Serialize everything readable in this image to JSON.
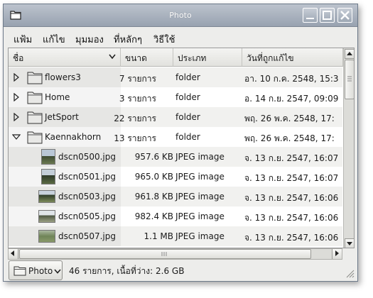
{
  "window": {
    "title": "Photo"
  },
  "menubar": {
    "items": [
      "แฟ้ม",
      "แก้ไข",
      "มุมมอง",
      "ที่หลักๆ",
      "วิธีใช้"
    ]
  },
  "columns": {
    "name": "ชื่อ",
    "size": "ขนาด",
    "type": "ประเภท",
    "modified": "วันที่ถูกแก้ไข"
  },
  "rows": [
    {
      "kind": "folder",
      "expanded": false,
      "name": "flowers3",
      "size": "7 รายการ",
      "type": "folder",
      "date": "อา. 10 ก.ค. 2548, 15:3"
    },
    {
      "kind": "folder",
      "expanded": false,
      "name": "Home",
      "size": "3 รายการ",
      "type": "folder",
      "date": "อ. 14 ก.ย. 2547, 09:09"
    },
    {
      "kind": "folder",
      "expanded": false,
      "name": "JetSport",
      "size": "22 รายการ",
      "type": "folder",
      "date": "พฤ. 26 พ.ค. 2548, 17:"
    },
    {
      "kind": "folder",
      "expanded": true,
      "name": "Kaennakhorn",
      "size": "13 รายการ",
      "type": "folder",
      "date": "พฤ. 26 พ.ค. 2548, 17:"
    },
    {
      "kind": "image",
      "name": "dscn0500.jpg",
      "size": "957.6 KB",
      "type": "JPEG image",
      "date": "จ. 13 ก.ย. 2547, 16:07"
    },
    {
      "kind": "image",
      "name": "dscn0501.jpg",
      "size": "965.0 KB",
      "type": "JPEG image",
      "date": "จ. 13 ก.ย. 2547, 16:07"
    },
    {
      "kind": "image",
      "name": "dscn0503.jpg",
      "size": "961.8 KB",
      "type": "JPEG image",
      "date": "จ. 13 ก.ย. 2547, 16:06"
    },
    {
      "kind": "image",
      "name": "dscn0505.jpg",
      "size": "982.4 KB",
      "type": "JPEG image",
      "date": "จ. 13 ก.ย. 2547, 16:06"
    },
    {
      "kind": "image",
      "name": "dscn0507.jpg",
      "size": "1.1 MB",
      "type": "JPEG image",
      "date": "จ. 13 ก.ย. 2547, 16:06"
    }
  ],
  "pathbar": {
    "label": "Photo"
  },
  "status": {
    "text": "46 รายการ, เนื้อที่ว่าง: 2.6 GB"
  },
  "colors": {
    "titlebar": "#a9b1bd",
    "window_bg": "#ededeb",
    "row_alt": "#f1f1ef"
  }
}
